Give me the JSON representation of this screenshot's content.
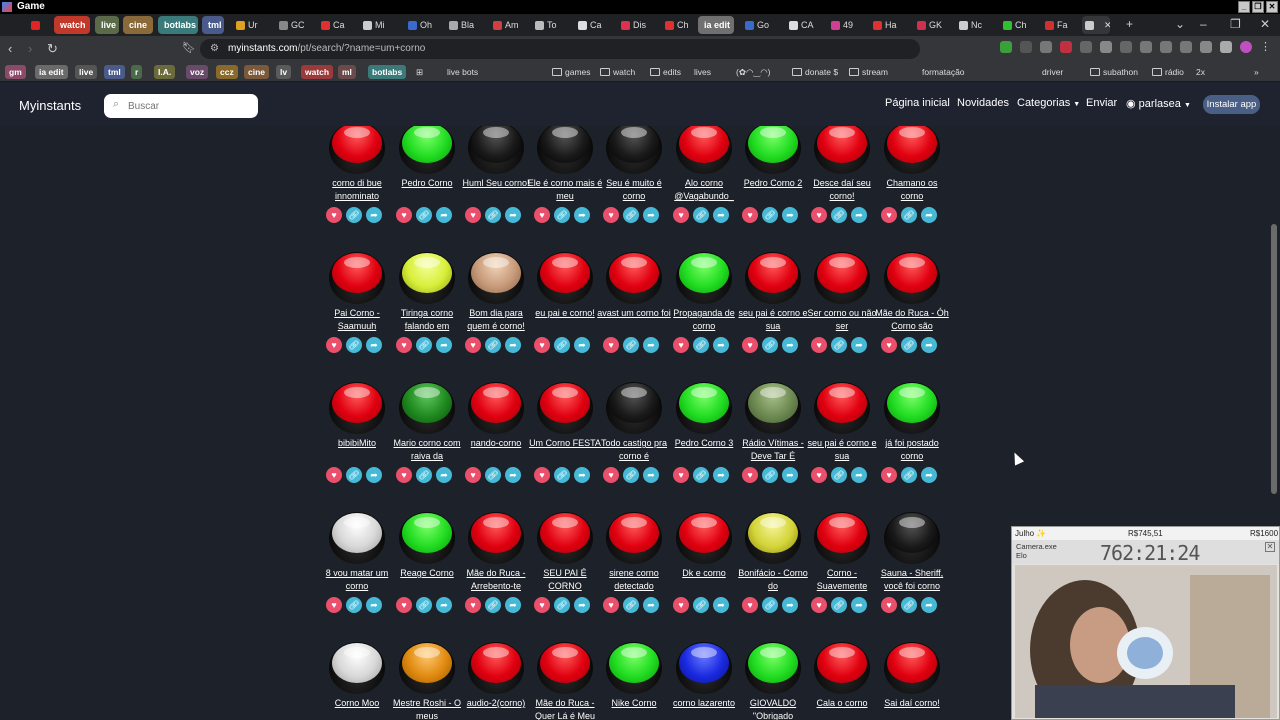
{
  "window": {
    "title": "Game"
  },
  "tabs": [
    {
      "label": "",
      "kind": "icon",
      "color": "#e02424"
    },
    {
      "label": "watch",
      "kind": "group",
      "color": "#c0392b"
    },
    {
      "label": "live",
      "kind": "group",
      "color": "#5b6b4a"
    },
    {
      "label": "cine",
      "kind": "group",
      "color": "#8b6a3a"
    },
    {
      "label": "botlabs",
      "kind": "group",
      "color": "#3a7a7a"
    },
    {
      "label": "tml",
      "kind": "group",
      "color": "#4a5a8a"
    },
    {
      "label": "Ur",
      "kind": "tab",
      "color": "#e0a020"
    },
    {
      "label": "GC",
      "kind": "tab",
      "color": "#888888"
    },
    {
      "label": "Ca",
      "kind": "tab",
      "color": "#e03030"
    },
    {
      "label": "Mi",
      "kind": "tab",
      "color": "#cccccc"
    },
    {
      "label": "Oh",
      "kind": "tab",
      "color": "#3a6acc"
    },
    {
      "label": "Bla",
      "kind": "tab",
      "color": "#aaaaaa"
    },
    {
      "label": "Am",
      "kind": "tab",
      "color": "#d04040"
    },
    {
      "label": "To",
      "kind": "tab",
      "color": "#bbbbbb"
    },
    {
      "label": "Ca",
      "kind": "tab",
      "color": "#dddddd"
    },
    {
      "label": "Dis",
      "kind": "tab",
      "color": "#e03050"
    },
    {
      "label": "Ch",
      "kind": "tab",
      "color": "#e03030"
    },
    {
      "label": "ia edit",
      "kind": "group",
      "color": "#707070"
    },
    {
      "label": "Go",
      "kind": "tab",
      "color": "#3a6acc"
    },
    {
      "label": "CA",
      "kind": "tab",
      "color": "#dddddd"
    },
    {
      "label": "49",
      "kind": "tab",
      "color": "#d04090"
    },
    {
      "label": "Ha",
      "kind": "tab",
      "color": "#e03030"
    },
    {
      "label": "GK",
      "kind": "tab",
      "color": "#d03050"
    },
    {
      "label": "Nc",
      "kind": "tab",
      "color": "#cccccc"
    },
    {
      "label": "Ch",
      "kind": "tab",
      "color": "#30c030"
    },
    {
      "label": "Fa",
      "kind": "tab",
      "color": "#d03030"
    },
    {
      "label": "",
      "kind": "active",
      "color": "#cccccc"
    }
  ],
  "address": {
    "host": "myinstants.com",
    "path": "/pt/search/?name=um+corno"
  },
  "bookmarks": [
    {
      "label": "gm",
      "kind": "chip",
      "color": "#8b4a6a"
    },
    {
      "label": "ia edit",
      "kind": "chip",
      "color": "#6a6a6a"
    },
    {
      "label": "live",
      "kind": "chip",
      "color": "#555555"
    },
    {
      "label": "tml",
      "kind": "chip",
      "color": "#4a5a8a"
    },
    {
      "label": "r",
      "kind": "chip",
      "color": "#4a6a4a"
    },
    {
      "label": "I.A.",
      "kind": "chip",
      "color": "#6a6a3a"
    },
    {
      "label": "voz",
      "kind": "chip",
      "color": "#6a4a6a"
    },
    {
      "label": "ccz",
      "kind": "chip",
      "color": "#8a6a2a"
    },
    {
      "label": "cine",
      "kind": "chip",
      "color": "#7a5a3a"
    },
    {
      "label": "lv",
      "kind": "chip",
      "color": "#5a5a5a"
    },
    {
      "label": "watch",
      "kind": "chip",
      "color": "#9a3a3a"
    },
    {
      "label": "ml",
      "kind": "chip",
      "color": "#6a4a4a"
    },
    {
      "label": "botlabs",
      "kind": "chip",
      "color": "#3a7a7a"
    },
    {
      "label": "live bots",
      "kind": "item"
    },
    {
      "label": "games",
      "kind": "folder"
    },
    {
      "label": "watch",
      "kind": "folder"
    },
    {
      "label": "edits",
      "kind": "folder"
    },
    {
      "label": "lives",
      "kind": "item"
    },
    {
      "label": "(✿◠‿◠)",
      "kind": "item"
    },
    {
      "label": "donate $",
      "kind": "folder"
    },
    {
      "label": "stream",
      "kind": "folder"
    },
    {
      "label": "formatação",
      "kind": "item"
    },
    {
      "label": "driver",
      "kind": "item"
    },
    {
      "label": "subathon",
      "kind": "folder"
    },
    {
      "label": "rádio",
      "kind": "folder"
    },
    {
      "label": "2x",
      "kind": "item"
    }
  ],
  "site": {
    "brand": "Myinstants",
    "search_placeholder": "Buscar",
    "nav": {
      "home": "Página inicial",
      "news": "Novidades",
      "categories": "Categorias",
      "send": "Enviar",
      "user": "parlasea",
      "install": "Instalar app"
    }
  },
  "sounds": [
    {
      "title": "corno di bue innominato",
      "color": "red"
    },
    {
      "title": "Pedro Corno",
      "color": "green"
    },
    {
      "title": "Huml Seu corno!",
      "color": "black"
    },
    {
      "title": "Ele é corno mais é meu",
      "color": "black"
    },
    {
      "title": "Seu é muito é corno",
      "color": "black"
    },
    {
      "title": "Alo corno @Vagabundo_",
      "color": "red"
    },
    {
      "title": "Pedro Corno 2",
      "color": "green"
    },
    {
      "title": "Desce daí seu corno!",
      "color": "red"
    },
    {
      "title": "Chamano os corno",
      "color": "red"
    },
    {
      "title": "Pai Corno - Saamuuh",
      "color": "red"
    },
    {
      "title": "Tiringa corno falando em",
      "color": "yellowgreen"
    },
    {
      "title": "Bom dia para quem é corno!",
      "color": "tan"
    },
    {
      "title": "eu pai e corno!",
      "color": "red"
    },
    {
      "title": "avast um corno foi",
      "color": "red"
    },
    {
      "title": "Propaganda de corno",
      "color": "green"
    },
    {
      "title": "seu pai é corno e sua",
      "color": "red"
    },
    {
      "title": "Ser corno ou não ser",
      "color": "red"
    },
    {
      "title": "Mãe do Ruca - Óh Corno são",
      "color": "red"
    },
    {
      "title": "bibibiMito",
      "color": "red"
    },
    {
      "title": "Mario corno com raiva da",
      "color": "darkgreen"
    },
    {
      "title": "nando-corno",
      "color": "red"
    },
    {
      "title": "Um Corno FESTA",
      "color": "red"
    },
    {
      "title": "Todo castigo pra corno é",
      "color": "black"
    },
    {
      "title": "Pedro Corno 3",
      "color": "green"
    },
    {
      "title": "Rádio Vítimas - Deve Tar É",
      "color": "olive"
    },
    {
      "title": "seu pai é corno e sua",
      "color": "red"
    },
    {
      "title": "já foi postado corno",
      "color": "green"
    },
    {
      "title": "8 vou matar um corno",
      "color": "white"
    },
    {
      "title": "Reage Corno",
      "color": "green"
    },
    {
      "title": "Mãe do Ruca - Arrebento-te",
      "color": "red"
    },
    {
      "title": "SEU PAI É CORNO",
      "color": "red"
    },
    {
      "title": "sirene corno detectado",
      "color": "red"
    },
    {
      "title": "Dk e corno",
      "color": "red"
    },
    {
      "title": "Bonifácio - Corno do",
      "color": "yellow"
    },
    {
      "title": "Corno - Suavemente",
      "color": "red"
    },
    {
      "title": "Sauna - Sheriff, você foi corno",
      "color": "black"
    },
    {
      "title": "Corno Moo",
      "color": "white"
    },
    {
      "title": "Mestre Roshi - O meus",
      "color": "orange"
    },
    {
      "title": "audio-2(corno)",
      "color": "red"
    },
    {
      "title": "Mãe do Ruca - Quer Lá é Meu",
      "color": "red"
    },
    {
      "title": "Nike Corno",
      "color": "green"
    },
    {
      "title": "corno lazarento",
      "color": "blue"
    },
    {
      "title": "GIOVALDO \"Obrigado",
      "color": "green"
    },
    {
      "title": "Cala o corno",
      "color": "red"
    },
    {
      "title": "Sai daí corno!",
      "color": "red"
    }
  ],
  "palette": {
    "red": [
      "#ff5a5a",
      "#e00010",
      "#a0000a"
    ],
    "green": [
      "#7dff6a",
      "#22dd22",
      "#0a9a0a"
    ],
    "black": [
      "#555555",
      "#1a1a1a",
      "#000000"
    ],
    "yellowgreen": [
      "#f5ff9a",
      "#d7ef3a",
      "#8fa010"
    ],
    "tan": [
      "#f0d3b8",
      "#c79b7a",
      "#8a6248"
    ],
    "darkgreen": [
      "#5fc65f",
      "#1f8a1f",
      "#0d4d0d"
    ],
    "olive": [
      "#a9c08a",
      "#6d8a52",
      "#3f5530"
    ],
    "white": [
      "#ffffff",
      "#d8d8d8",
      "#9a9a9a"
    ],
    "yellow": [
      "#f5f59a",
      "#d4d43a",
      "#8a8a10"
    ],
    "orange": [
      "#ffc870",
      "#e08a10",
      "#9a5a00"
    ],
    "blue": [
      "#6a7aff",
      "#1a2ae0",
      "#0a108a"
    ]
  },
  "overlay": {
    "month": "Julho ✨",
    "amount_left": "R$745,51",
    "amount_right": "R$1600",
    "app": "Camera.exe",
    "app_sub": "Elo",
    "clock": "762:21:24"
  }
}
